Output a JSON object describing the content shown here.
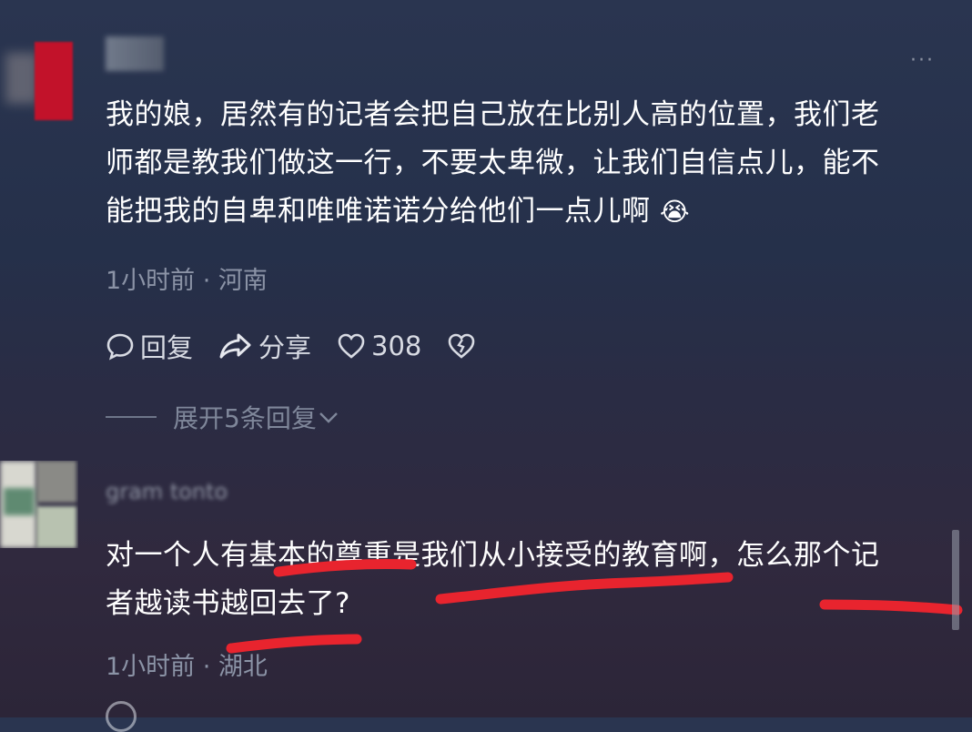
{
  "comments": [
    {
      "username": "川",
      "text_lines": [
        "我的娘，居然有的记者会把自己放在比别人高的位置，我们老",
        "师都是教我们做这一行，不要太卑微，让我们自信点儿，能不",
        "能把我的自卑和唯唯诺诺分给他们一点儿啊"
      ],
      "emoji": "😭",
      "meta": "1小时前 · 河南",
      "actions": {
        "reply": "回复",
        "share": "分享",
        "likes": "308"
      },
      "expand_replies": "展开5条回复"
    },
    {
      "username": "gram tonto",
      "text_lines": [
        "对一个人有基本的尊重是我们从小接受的教育啊，怎么那个记",
        "者越读书越回去了?"
      ],
      "meta": "1小时前 · 湖北"
    }
  ],
  "icons": {
    "more": "more-dots-icon",
    "reply": "comment-bubble-icon",
    "share": "share-arrow-icon",
    "like": "heart-icon",
    "dislike": "broken-heart-icon",
    "expand": "chevron-down-icon"
  },
  "colors": {
    "text": "#ffffff",
    "meta": "#8b93a6",
    "annotation": "#e8242e"
  }
}
